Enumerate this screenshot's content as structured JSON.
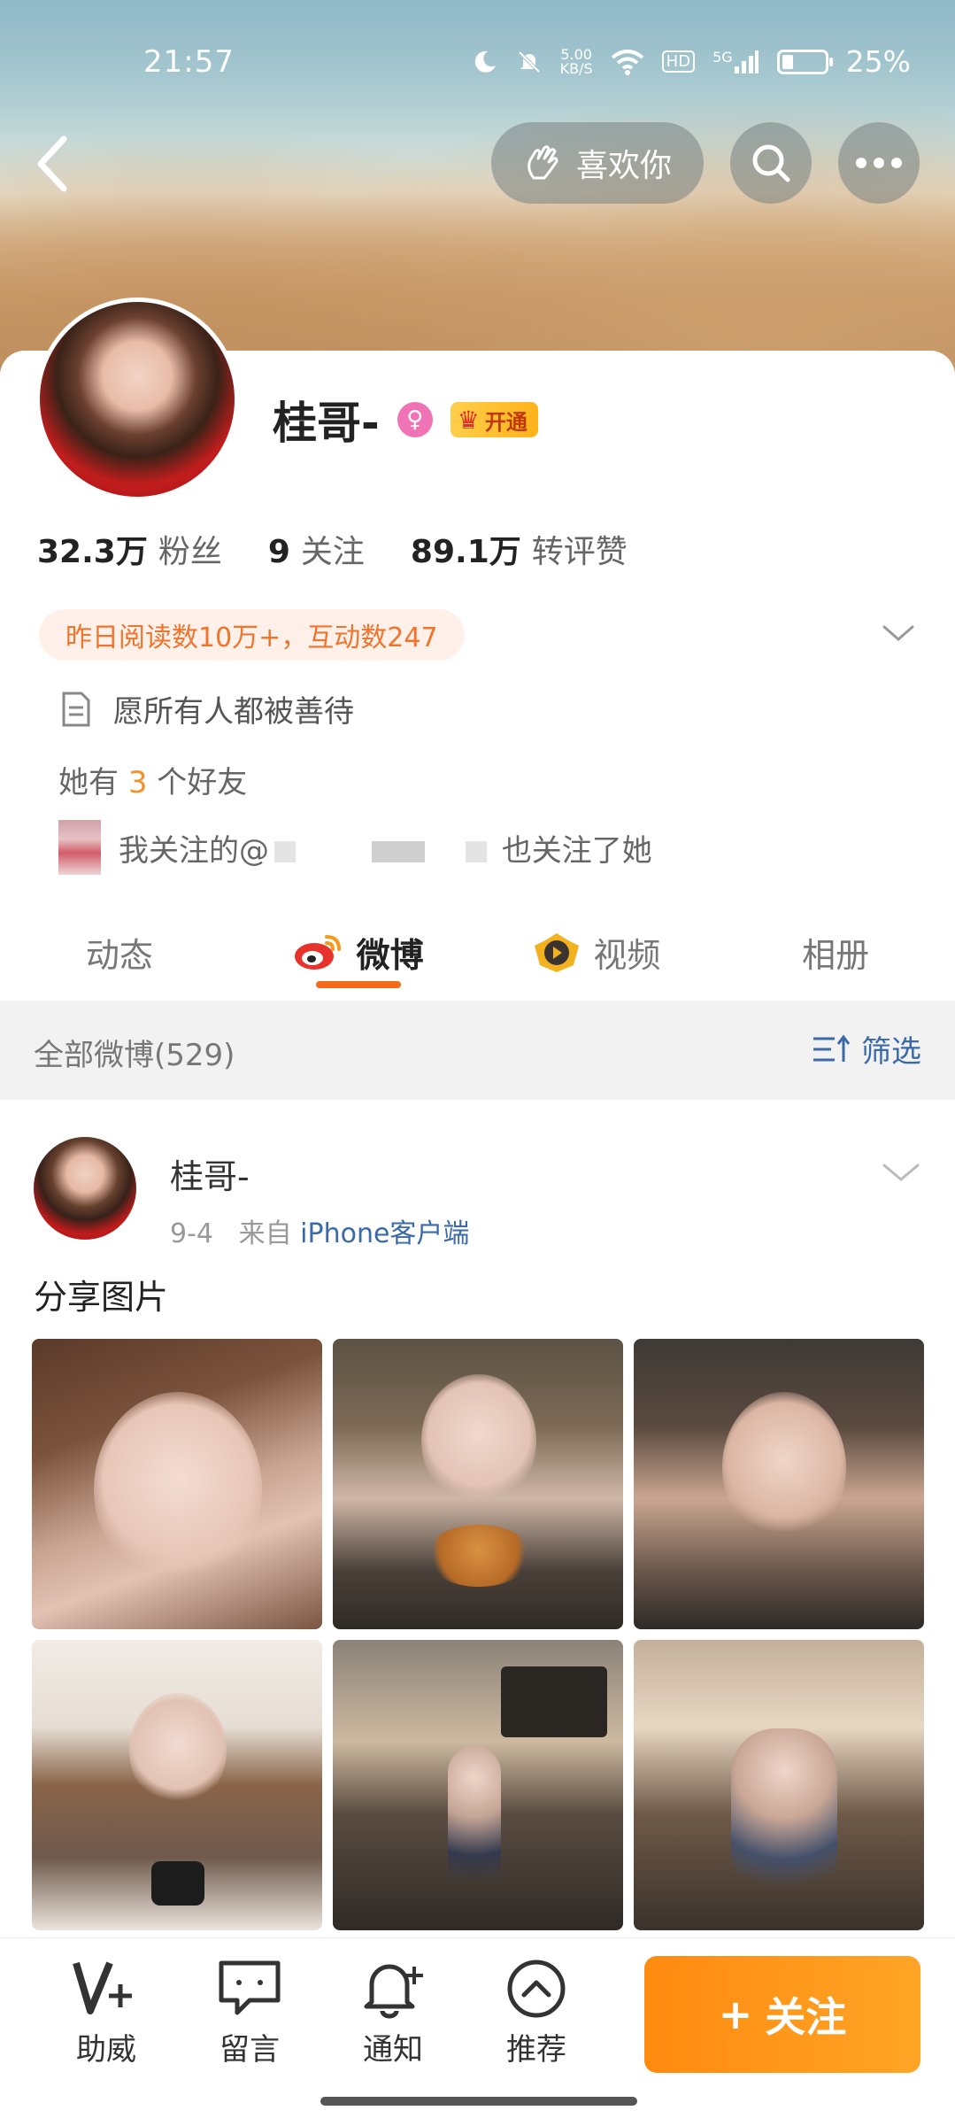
{
  "status_bar": {
    "time": "21:57",
    "net_speed_value": "5.00",
    "net_speed_unit": "KB/S",
    "hd_label": "HD",
    "signal_label": "5G",
    "battery_percent": "25%",
    "battery_level": 0.25
  },
  "header": {
    "like_label": "喜欢你"
  },
  "profile": {
    "name": "桂哥-",
    "gender_symbol": "♀",
    "vip_label": "开通",
    "stats": {
      "fans_value": "32.3万",
      "fans_label": "粉丝",
      "following_value": "9",
      "following_label": "关注",
      "interactions_value": "89.1万",
      "interactions_label": "转评赞"
    },
    "reading_info": "昨日阅读数10万+，互动数247",
    "bio": "愿所有人都被善待",
    "friends_prefix": "她有",
    "friends_count": "3",
    "friends_suffix": "个好友",
    "mutual_prefix": "我关注的@",
    "mutual_suffix": "也关注了她"
  },
  "tabs": [
    {
      "label": "动态"
    },
    {
      "label": "微博"
    },
    {
      "label": "视频"
    },
    {
      "label": "相册"
    }
  ],
  "filter": {
    "count_label": "全部微博(529)",
    "filter_label": "筛选"
  },
  "post": {
    "author": "桂哥-",
    "date": "9-4",
    "from_prefix": "来自",
    "source": "iPhone客户端",
    "text": "分享图片"
  },
  "bottom_bar": {
    "items": [
      {
        "label": "助威",
        "icon": "support-v-icon"
      },
      {
        "label": "留言",
        "icon": "message-icon"
      },
      {
        "label": "通知",
        "icon": "bell-plus-icon"
      },
      {
        "label": "推荐",
        "icon": "chevron-up-circle-icon"
      }
    ],
    "follow_label": "关注",
    "follow_plus": "+"
  },
  "colors": {
    "accent_orange": "#ff8a10",
    "link_blue": "#3b6aa8",
    "tab_underline": "#f36a1b",
    "gender_pink": "#f074b5"
  }
}
